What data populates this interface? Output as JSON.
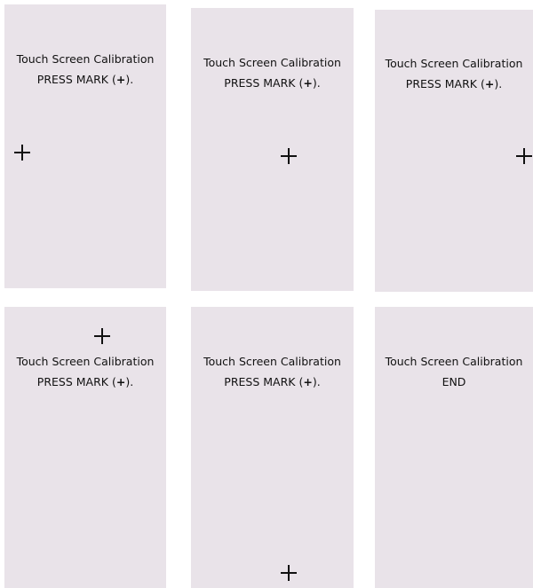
{
  "panels": [
    {
      "title": "Touch Screen Calibration",
      "message_prefix": "PRESS MARK (",
      "message_symbol": "+",
      "message_suffix": ")."
    },
    {
      "title": "Touch Screen Calibration",
      "message_prefix": "PRESS MARK (",
      "message_symbol": "+",
      "message_suffix": ")."
    },
    {
      "title": "Touch Screen Calibration",
      "message_prefix": "PRESS MARK (",
      "message_symbol": "+",
      "message_suffix": ")."
    },
    {
      "title": "Touch Screen Calibration",
      "message_prefix": "PRESS MARK (",
      "message_symbol": "+",
      "message_suffix": ")."
    },
    {
      "title": "Touch Screen Calibration",
      "message_prefix": "PRESS MARK (",
      "message_symbol": "+",
      "message_suffix": ")."
    },
    {
      "title": "Touch Screen Calibration",
      "message": "END"
    }
  ],
  "colors": {
    "panel_background": "#e9e3e9",
    "text": "#111111",
    "page_background": "#ffffff"
  },
  "icons": {
    "calibration_mark": "crosshair-plus-icon"
  }
}
